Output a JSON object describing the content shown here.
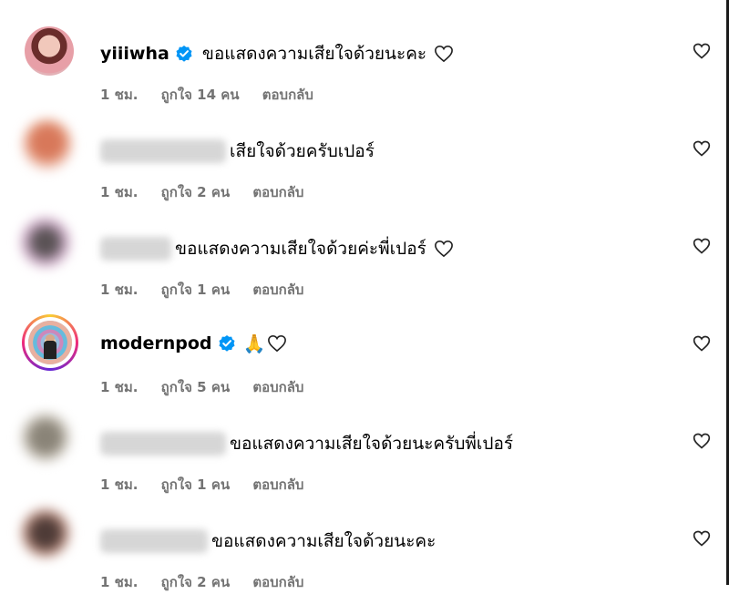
{
  "comments": [
    {
      "username": "yiiiwha",
      "verified": true,
      "text": "ขอแสดงความเสียใจด้วยนะคะ",
      "trailing_heart": true,
      "time": "1 ชม.",
      "likes": "ถูกใจ 14 คน",
      "reply": "ตอบกลับ"
    },
    {
      "username": "",
      "verified": false,
      "text": "เสียใจด้วยครับเปอร์",
      "trailing_heart": false,
      "time": "1 ชม.",
      "likes": "ถูกใจ 2 คน",
      "reply": "ตอบกลับ"
    },
    {
      "username": "",
      "verified": false,
      "text": "ขอแสดงความเสียใจด้วยค่ะพี่เปอร์",
      "trailing_heart": true,
      "time": "1 ชม.",
      "likes": "ถูกใจ 1 คน",
      "reply": "ตอบกลับ"
    },
    {
      "username": "modernpod",
      "verified": true,
      "text": "🙏",
      "trailing_heart": true,
      "time": "1 ชม.",
      "likes": "ถูกใจ 5 คน",
      "reply": "ตอบกลับ"
    },
    {
      "username": "",
      "verified": false,
      "text": "ขอแสดงความเสียใจด้วยนะครับพี่เปอร์",
      "trailing_heart": false,
      "time": "1 ชม.",
      "likes": "ถูกใจ 1 คน",
      "reply": "ตอบกลับ"
    },
    {
      "username": "",
      "verified": false,
      "text": "ขอแสดงความเสียใจด้วยนะคะ",
      "trailing_heart": false,
      "time": "1 ชม.",
      "likes": "ถูกใจ 2 คน",
      "reply": "ตอบกลับ"
    }
  ],
  "colors": {
    "meta_text": "#737373",
    "verified_badge": "#0095f6"
  },
  "icons": {
    "like": "heart-outline-icon",
    "verified": "verified-badge-icon"
  }
}
